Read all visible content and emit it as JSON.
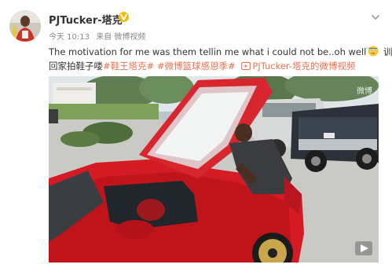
{
  "post": {
    "username": "PJTucker-塔克",
    "verified_icon": "verified-badge-icon",
    "time": "今天 10:13",
    "source": "来自 微博视频",
    "text_line1": "The motivation for me was them tellin me what i could not be..oh well",
    "emoji_icon": "emoji-face-icon",
    "text_line1_tail": " 训练完",
    "text_line2": "回家拍鞋子喽",
    "tags": [
      "#鞋王塔克#",
      "#微博篮球感恩季#"
    ],
    "video_link": "PJTucker-塔克的微博视频",
    "video_link_icon": "play-video-icon"
  },
  "video": {
    "watermark": "微博",
    "scene": "man opening the hood of a red sports car in a parking lot"
  },
  "colors": {
    "link": "#eb7350",
    "badge": "#f5b800",
    "car": "#d41a22"
  }
}
